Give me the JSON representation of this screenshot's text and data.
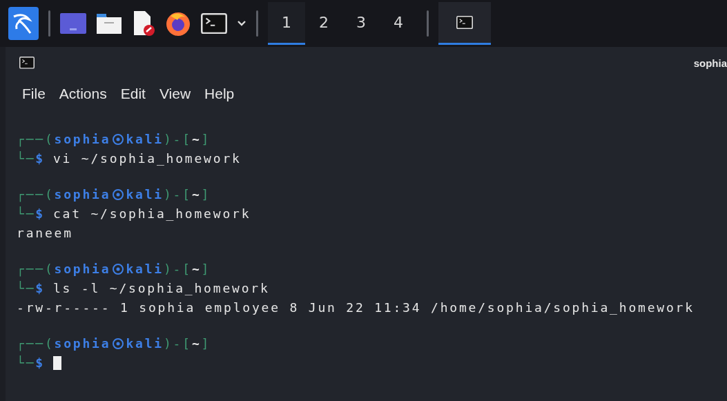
{
  "taskbar": {
    "launchers": [
      {
        "kind": "desktop"
      },
      {
        "kind": "files"
      },
      {
        "kind": "editor"
      },
      {
        "kind": "browser"
      },
      {
        "kind": "terminal"
      }
    ],
    "workspaces": [
      {
        "label": "1",
        "selected": true
      },
      {
        "label": "2",
        "selected": false
      },
      {
        "label": "3",
        "selected": false
      },
      {
        "label": "4",
        "selected": false
      }
    ],
    "tasks": [
      {
        "kind": "terminal",
        "selected": true
      }
    ]
  },
  "window": {
    "title": "sophia"
  },
  "menu": [
    "File",
    "Actions",
    "Edit",
    "View",
    "Help"
  ],
  "terminal": {
    "blocks": [
      {
        "open": "┌──(",
        "user": "sophia",
        "host": "kali",
        "mid": ")-[",
        "path": "~",
        "close": "]",
        "corner": "└─",
        "dollar": "$",
        "command": "vi ~/sophia_homework",
        "cursor": false
      },
      {
        "open": "┌──(",
        "user": "sophia",
        "host": "kali",
        "mid": ")-[",
        "path": "~",
        "close": "]",
        "corner": "└─",
        "dollar": "$",
        "command": "cat ~/sophia_homework",
        "output": [
          "raneem"
        ],
        "cursor": false
      },
      {
        "open": "┌──(",
        "user": "sophia",
        "host": "kali",
        "mid": ")-[",
        "path": "~",
        "close": "]",
        "corner": "└─",
        "dollar": "$",
        "command": "ls -l ~/sophia_homework",
        "output": [
          "-rw-r----- 1 sophia employee 8 Jun 22 11:34 /home/sophia/sophia_homework"
        ],
        "cursor": false
      },
      {
        "open": "┌──(",
        "user": "sophia",
        "host": "kali",
        "mid": ")-[",
        "path": "~",
        "close": "]",
        "corner": "└─",
        "dollar": "$",
        "cursor": true
      }
    ]
  }
}
